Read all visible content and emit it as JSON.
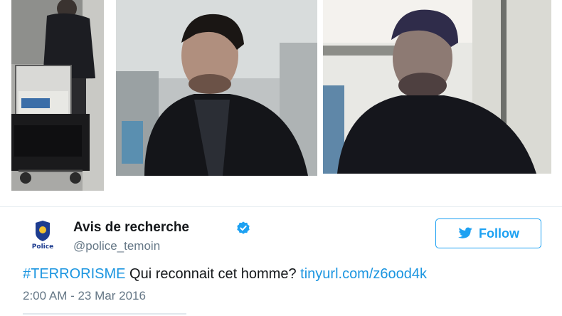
{
  "tweet": {
    "display_name": "Avis de recherche",
    "handle": "@police_temoin",
    "follow_label": "Follow",
    "hashtag": "#TERRORISME",
    "text": " Qui reconnait cet homme? ",
    "link": "tinyurl.com/z6ood4k",
    "timestamp": "2:00 AM - 23 Mar 2016",
    "avatar_label": "Police"
  },
  "icons": {
    "verified": "verified-badge-icon",
    "follow": "twitter-bird-icon"
  },
  "colors": {
    "brand_blue": "#1da1f2",
    "link_blue": "#1b95e0",
    "text": "#14171a",
    "muted": "#657786"
  }
}
